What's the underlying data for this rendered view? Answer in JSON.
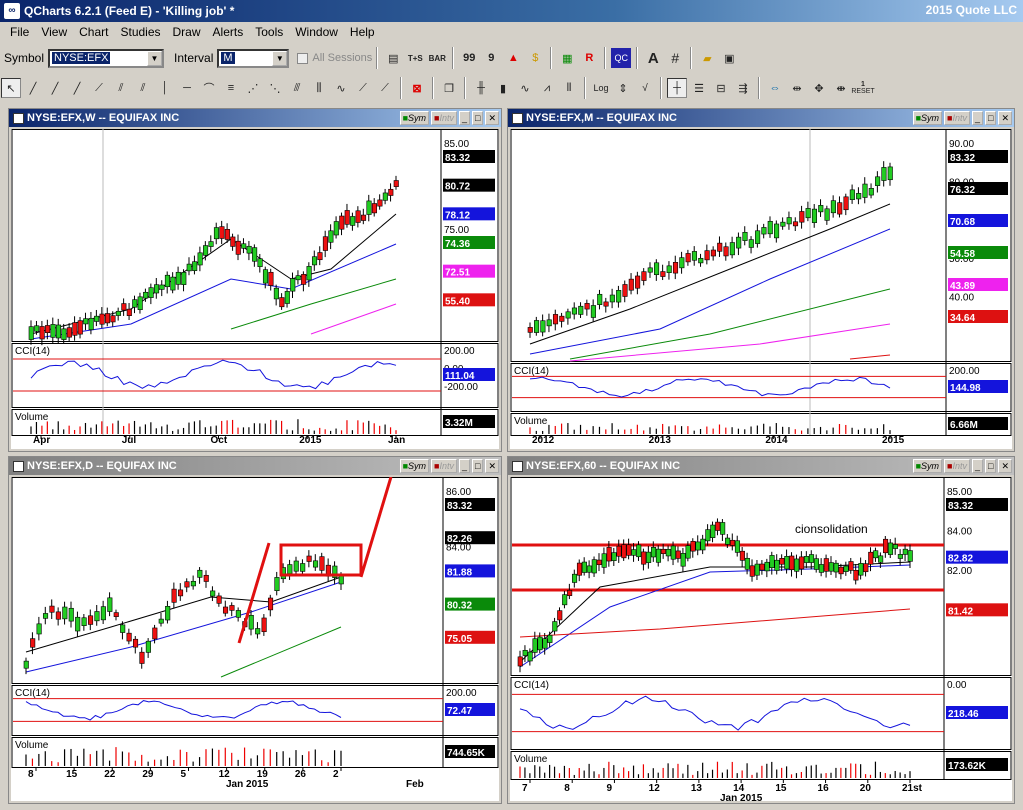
{
  "app": {
    "title": "QCharts 6.2.1 (Feed E) - 'Killing job' *",
    "company": "2015 Quote LLC",
    "icon": "qcharts-icon"
  },
  "menu": [
    "File",
    "View",
    "Chart",
    "Studies",
    "Draw",
    "Alerts",
    "Tools",
    "Window",
    "Help"
  ],
  "toolbar": {
    "symbol_label": "Symbol",
    "symbol_value": "NYSE:EFX",
    "interval_label": "Interval",
    "interval_value": "M",
    "all_sessions": "All Sessions"
  },
  "toolbar_icons": [
    "T+S",
    "BAR",
    "Log",
    "AC",
    "RESET"
  ],
  "panels": [
    {
      "title": "NYSE:EFX,W -- EQUIFAX INC",
      "sym": "Sym",
      "intv": "Intv",
      "active": true,
      "price_ticks": [
        "85.00",
        "80.00",
        "75.00",
        "70.00"
      ],
      "labels": [
        {
          "v": "83.32",
          "c": "#000000"
        },
        {
          "v": "80.72",
          "c": "#000000"
        },
        {
          "v": "78.12",
          "c": "#1414dc"
        },
        {
          "v": "74.36",
          "c": "#0a8a0a"
        },
        {
          "v": "72.51",
          "c": "#ee22ee"
        },
        {
          "v": "55.40",
          "c": "#dd1111"
        }
      ],
      "cci_label": "CCI(14)",
      "cci_ticks": [
        "200.00",
        "0.00",
        "-200.00"
      ],
      "cci_value": "111.04",
      "vol_label": "Volume",
      "vol_value": "3.32M",
      "xticks": [
        "Apr",
        "Jul",
        "Oct",
        "2015",
        "Jan"
      ]
    },
    {
      "title": "NYSE:EFX,M -- EQUIFAX INC",
      "sym": "Sym",
      "intv": "Intv",
      "active": false,
      "price_ticks": [
        "90.00",
        "80.00",
        "60.00",
        "50.00",
        "40.00"
      ],
      "labels": [
        {
          "v": "83.32",
          "c": "#000000"
        },
        {
          "v": "76.32",
          "c": "#000000"
        },
        {
          "v": "70.68",
          "c": "#1414dc"
        },
        {
          "v": "54.58",
          "c": "#0a8a0a"
        },
        {
          "v": "43.89",
          "c": "#ee22ee"
        },
        {
          "v": "34.64",
          "c": "#dd1111"
        }
      ],
      "cci_label": "CCI(14)",
      "cci_ticks": [
        "200.00",
        "100.00"
      ],
      "cci_value": "144.98",
      "vol_label": "Volume",
      "vol_value": "6.66M",
      "xticks": [
        "2012",
        "2013",
        "2014",
        "2015"
      ]
    },
    {
      "title": "NYSE:EFX,D -- EQUIFAX INC",
      "sym": "Sym",
      "intv": "Intv",
      "active": false,
      "price_ticks": [
        "86.00",
        "84.00",
        "82.00"
      ],
      "labels": [
        {
          "v": "83.32",
          "c": "#000000"
        },
        {
          "v": "82.26",
          "c": "#000000"
        },
        {
          "v": "81.88",
          "c": "#1414dc"
        },
        {
          "v": "80.32",
          "c": "#0a8a0a"
        },
        {
          "v": "75.05",
          "c": "#dd1111"
        }
      ],
      "cci_label": "CCI(14)",
      "cci_ticks": [
        "200.00",
        "0.00"
      ],
      "cci_value": "72.47",
      "vol_label": "Volume",
      "vol_value": "744.65K",
      "xticks": [
        "8",
        "15",
        "22",
        "29",
        "5",
        "12",
        "19",
        "26",
        "2"
      ],
      "xsub": [
        "Jan 2015",
        "Feb"
      ]
    },
    {
      "title": "NYSE:EFX,60 -- EQUIFAX INC",
      "sym": "Sym",
      "intv": "Intv",
      "active": false,
      "price_ticks": [
        "85.00",
        "84.00",
        "82.00",
        "81.00"
      ],
      "labels": [
        {
          "v": "83.32",
          "c": "#000000"
        },
        {
          "v": "82.82",
          "c": "#1414dc"
        },
        {
          "v": "81.42",
          "c": "#dd1111"
        }
      ],
      "annotation": "cionsolidation",
      "cci_label": "CCI(14)",
      "cci_ticks": [
        "0.00",
        "-200.00"
      ],
      "cci_value": "218.46",
      "vol_label": "Volume",
      "vol_value": "173.62K",
      "xticks": [
        "7",
        "8",
        "9",
        "12",
        "13",
        "14",
        "15",
        "16",
        "20",
        "21st"
      ],
      "xsub": [
        "Jan 2015"
      ]
    }
  ]
}
